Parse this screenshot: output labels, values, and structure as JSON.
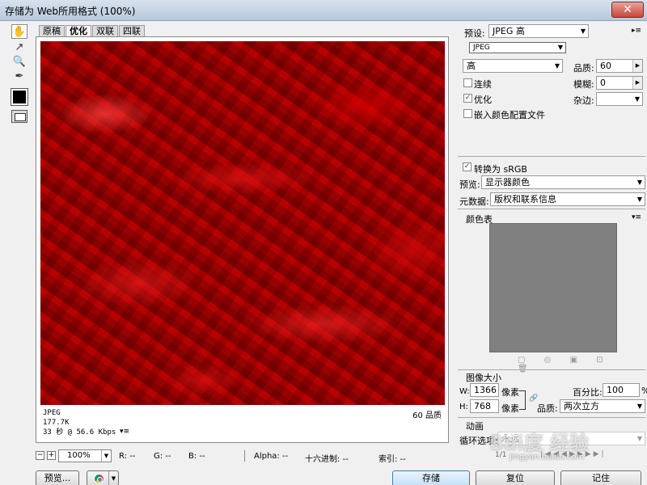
{
  "window": {
    "title": "存储为 Web所用格式 (100%)",
    "close_label": "✕"
  },
  "tools": [
    {
      "icon": "hand-icon",
      "glyph": "✋"
    },
    {
      "icon": "slice-select-icon",
      "glyph": "↗"
    },
    {
      "icon": "zoom-icon",
      "glyph": "🔍"
    },
    {
      "icon": "eyedropper-icon",
      "glyph": "✒"
    }
  ],
  "tabs": [
    "原稿",
    "优化",
    "双联",
    "四联"
  ],
  "active_tab": "优化",
  "image_info": {
    "format": "JPEG",
    "size": "177.7K",
    "time": "33 秒 @ 56.6 Kbps",
    "quality_label": "60 品质",
    "menu": "▾≡"
  },
  "statusbar": {
    "zoom_minus": "−",
    "zoom_plus": "+",
    "zoom": "100%",
    "r": "R: --",
    "g": "G: --",
    "b": "B: --",
    "alpha": "Alpha: --",
    "hex": "十六进制: --",
    "index": "索引: --"
  },
  "buttons": {
    "preview": "预览...",
    "save": "存储",
    "reset": "复位",
    "remember": "记住"
  },
  "settings": {
    "preset_label": "预设:",
    "preset_value": "JPEG 高",
    "format_value": "JPEG",
    "quality_preset": "高",
    "quality_label": "品质:",
    "quality_value": "60",
    "blur_label": "模糊:",
    "blur_value": "0",
    "matte_label": "杂边:",
    "progressive_label": "连续",
    "optimized_label": "优化",
    "embed_profile_label": "嵌入颜色配置文件",
    "convert_srgb_label": "转换为 sRGB",
    "preview_label": "预览:",
    "preview_value": "显示器颜色",
    "metadata_label": "元数据:",
    "metadata_value": "版权和联系信息"
  },
  "color_table": {
    "title": "颜色表"
  },
  "image_size": {
    "title": "图像大小",
    "w_label": "W:",
    "w_value": "1366",
    "h_label": "H:",
    "h_value": "768",
    "unit": "像素",
    "percent_label": "百分比:",
    "percent_value": "100",
    "percent_unit": "%",
    "quality_label": "品质:",
    "quality_value": "两次立方"
  },
  "animation": {
    "title": "动画",
    "loop_label": "循环选项:",
    "loop_value": "永远",
    "frame": "1/1"
  },
  "watermark": {
    "text": "Bai度 经验",
    "sub": "jingyan.baidu.com"
  }
}
